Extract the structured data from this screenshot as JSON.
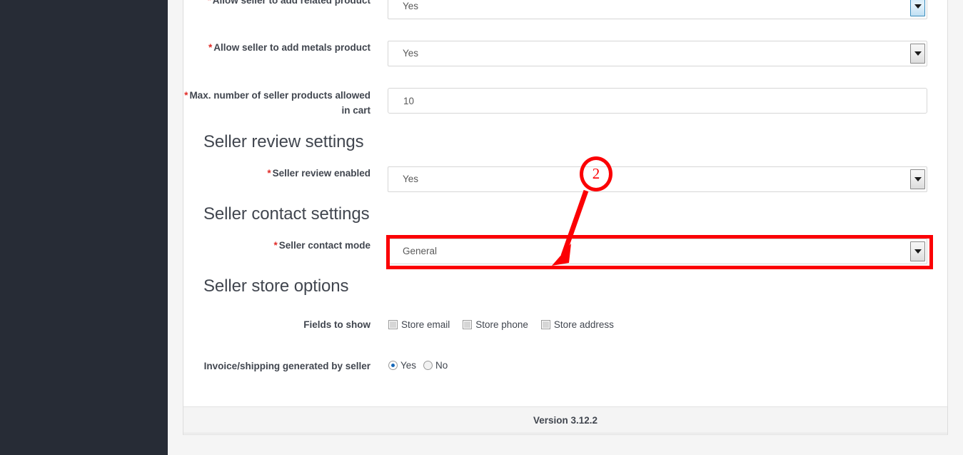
{
  "app": {
    "version_label": "Version 3.12.2"
  },
  "form": {
    "rows": [
      {
        "id": "allow-related-product",
        "label": "Allow seller to add related product",
        "required": true,
        "control": "select",
        "value": "Yes",
        "focused": true
      },
      {
        "id": "allow-metals-product",
        "label": "Allow seller to add metals product",
        "required": true,
        "control": "select",
        "value": "Yes",
        "focused": false
      },
      {
        "id": "max-seller-products-in-cart",
        "label": "Max. number of seller products allowed in cart",
        "required": true,
        "control": "text",
        "value": "10",
        "placeholder": ""
      },
      {
        "id": "seller-review-enabled",
        "label": "Seller review enabled",
        "required": true,
        "control": "select",
        "value": "Yes",
        "focused": false
      },
      {
        "id": "seller-contact-mode",
        "label": "Seller contact mode",
        "required": true,
        "control": "select",
        "value": "General",
        "focused": false,
        "highlighted": true
      }
    ],
    "sections": [
      {
        "id": "seller-review-settings",
        "title": "Seller review settings"
      },
      {
        "id": "seller-contact-settings",
        "title": "Seller contact settings"
      },
      {
        "id": "seller-store-options",
        "title": "Seller store options"
      }
    ],
    "fields_to_show": {
      "label": "Fields to show",
      "required": false,
      "options": [
        {
          "label": "Store email",
          "checked": false
        },
        {
          "label": "Store phone",
          "checked": false
        },
        {
          "label": "Store address",
          "checked": false
        }
      ]
    },
    "invoice_shipping": {
      "label": "Invoice/shipping generated by seller",
      "required": false,
      "options": [
        {
          "label": "Yes",
          "checked": true
        },
        {
          "label": "No",
          "checked": false
        }
      ]
    }
  },
  "annotation": {
    "badge_number": "2",
    "color": "#fb0004",
    "target_row": "seller-contact-mode"
  }
}
